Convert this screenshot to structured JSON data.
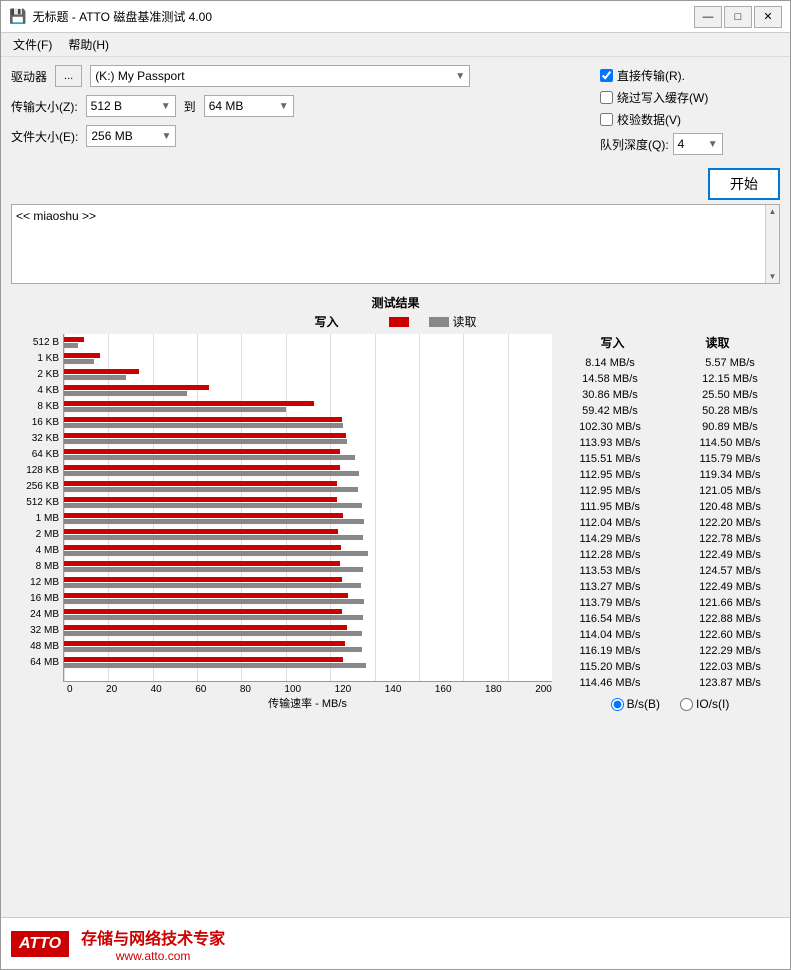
{
  "window": {
    "title": "无标题 - ATTO 磁盘基准测试 4.00",
    "controls": {
      "minimize": "—",
      "maximize": "□",
      "close": "✕"
    }
  },
  "menu": {
    "items": [
      "文件(F)",
      "帮助(H)"
    ]
  },
  "form": {
    "driver_label": "驱动器",
    "browse_label": "...",
    "drive_value": "(K:) My Passport",
    "transfer_size_label": "传输大小(Z):",
    "transfer_from": "512 B",
    "transfer_to_label": "到",
    "transfer_to": "64 MB",
    "file_size_label": "文件大小(E):",
    "file_size": "256 MB"
  },
  "options": {
    "direct_transfer": "直接传输(R).",
    "bypass_write_cache": "绕过写入缓存(W)",
    "verify_data": "校验数据(V)",
    "queue_depth_label": "队列深度(Q):",
    "queue_depth_value": "4",
    "start_button": "开始"
  },
  "log": {
    "content": "<< miaoshu >>"
  },
  "chart": {
    "title": "测试结果",
    "legend": {
      "write_label": "写入",
      "read_label": "读取"
    },
    "y_labels": [
      "512 B",
      "1 KB",
      "2 KB",
      "4 KB",
      "8 KB",
      "16 KB",
      "32 KB",
      "64 KB",
      "128 KB",
      "256 KB",
      "512 KB",
      "1 MB",
      "2 MB",
      "4 MB",
      "8 MB",
      "12 MB",
      "16 MB",
      "24 MB",
      "32 MB",
      "48 MB",
      "64 MB"
    ],
    "x_labels": [
      "0",
      "20",
      "40",
      "60",
      "80",
      "100",
      "120",
      "140",
      "160",
      "180",
      "200"
    ],
    "x_title": "传输速率 - MB/s",
    "max_speed": 200,
    "bars": [
      {
        "write": 8.14,
        "read": 5.57
      },
      {
        "write": 14.58,
        "read": 12.15
      },
      {
        "write": 30.86,
        "read": 25.5
      },
      {
        "write": 59.42,
        "read": 50.28
      },
      {
        "write": 102.3,
        "read": 90.89
      },
      {
        "write": 113.93,
        "read": 114.5
      },
      {
        "write": 115.51,
        "read": 115.79
      },
      {
        "write": 112.95,
        "read": 119.34
      },
      {
        "write": 112.95,
        "read": 121.05
      },
      {
        "write": 111.95,
        "read": 120.48
      },
      {
        "write": 112.04,
        "read": 122.2
      },
      {
        "write": 114.29,
        "read": 122.78
      },
      {
        "write": 112.28,
        "read": 122.49
      },
      {
        "write": 113.53,
        "read": 124.57
      },
      {
        "write": 113.27,
        "read": 122.49
      },
      {
        "write": 113.79,
        "read": 121.66
      },
      {
        "write": 116.54,
        "read": 122.88
      },
      {
        "write": 114.04,
        "read": 122.6
      },
      {
        "write": 116.19,
        "read": 122.29
      },
      {
        "write": 115.2,
        "read": 122.03
      },
      {
        "write": 114.46,
        "read": 123.87
      }
    ]
  },
  "stats": {
    "write_col": "写入",
    "read_col": "读取",
    "rows": [
      {
        "write": "8.14 MB/s",
        "read": "5.57 MB/s"
      },
      {
        "write": "14.58 MB/s",
        "read": "12.15 MB/s"
      },
      {
        "write": "30.86 MB/s",
        "read": "25.50 MB/s"
      },
      {
        "write": "59.42 MB/s",
        "read": "50.28 MB/s"
      },
      {
        "write": "102.30 MB/s",
        "read": "90.89 MB/s"
      },
      {
        "write": "113.93 MB/s",
        "read": "114.50 MB/s"
      },
      {
        "write": "115.51 MB/s",
        "read": "115.79 MB/s"
      },
      {
        "write": "112.95 MB/s",
        "read": "119.34 MB/s"
      },
      {
        "write": "112.95 MB/s",
        "read": "121.05 MB/s"
      },
      {
        "write": "111.95 MB/s",
        "read": "120.48 MB/s"
      },
      {
        "write": "112.04 MB/s",
        "read": "122.20 MB/s"
      },
      {
        "write": "114.29 MB/s",
        "read": "122.78 MB/s"
      },
      {
        "write": "112.28 MB/s",
        "read": "122.49 MB/s"
      },
      {
        "write": "113.53 MB/s",
        "read": "124.57 MB/s"
      },
      {
        "write": "113.27 MB/s",
        "read": "122.49 MB/s"
      },
      {
        "write": "113.79 MB/s",
        "read": "121.66 MB/s"
      },
      {
        "write": "116.54 MB/s",
        "read": "122.88 MB/s"
      },
      {
        "write": "114.04 MB/s",
        "read": "122.60 MB/s"
      },
      {
        "write": "116.19 MB/s",
        "read": "122.29 MB/s"
      },
      {
        "write": "115.20 MB/s",
        "read": "122.03 MB/s"
      },
      {
        "write": "114.46 MB/s",
        "read": "123.87 MB/s"
      }
    ]
  },
  "radio": {
    "bytes_label": "B/s(B)",
    "io_label": "IO/s(I)"
  },
  "footer": {
    "logo": "ATTO",
    "tagline": "存储与网络技术专家",
    "website": "www.atto.com"
  }
}
